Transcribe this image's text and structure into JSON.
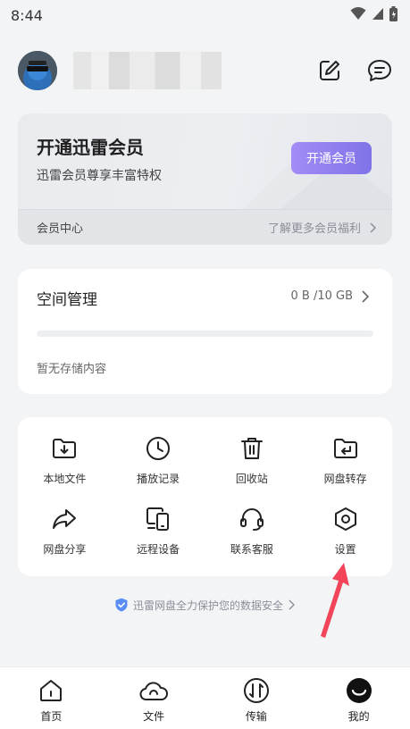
{
  "status": {
    "time": "8:44"
  },
  "vip": {
    "title": "开通迅雷会员",
    "subtitle": "迅雷会员尊享丰富特权",
    "button": "开通会员",
    "center": "会员中心",
    "more": "了解更多会员福利"
  },
  "space": {
    "title": "空间管理",
    "usage": "0 B /10 GB",
    "used_fraction": 0,
    "empty": "暂无存储内容"
  },
  "tools": [
    {
      "label": "本地文件",
      "icon": "folder-download-icon"
    },
    {
      "label": "播放记录",
      "icon": "clock-icon"
    },
    {
      "label": "回收站",
      "icon": "trash-icon"
    },
    {
      "label": "网盘转存",
      "icon": "folder-return-icon"
    },
    {
      "label": "网盘分享",
      "icon": "share-arrow-icon"
    },
    {
      "label": "远程设备",
      "icon": "devices-icon"
    },
    {
      "label": "联系客服",
      "icon": "headset-icon"
    },
    {
      "label": "设置",
      "icon": "hexagon-settings-icon"
    }
  ],
  "secure_note": "迅雷网盘全力保护您的数据安全",
  "tabs": [
    {
      "label": "首页",
      "icon": "home-icon"
    },
    {
      "label": "文件",
      "icon": "cloud-icon"
    },
    {
      "label": "传输",
      "icon": "transfer-icon"
    },
    {
      "label": "我的",
      "icon": "profile-face-icon"
    }
  ],
  "colors": {
    "vip_button_start": "#a38cf6",
    "vip_button_end": "#7f73e8",
    "shield": "#5b8df6",
    "annotation_arrow": "#f2455a"
  }
}
